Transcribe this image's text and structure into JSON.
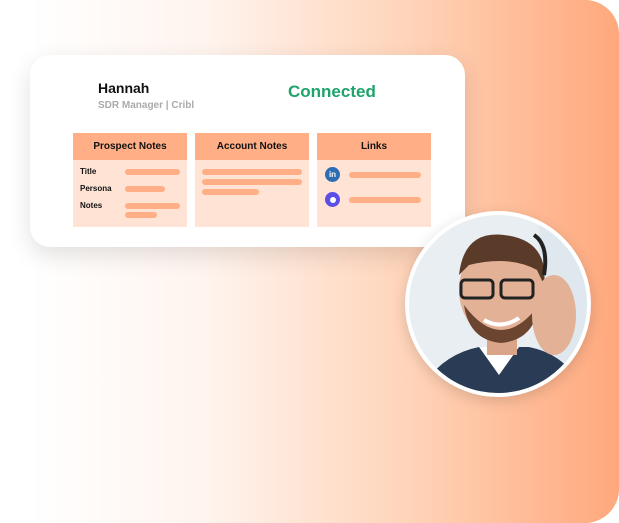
{
  "contact": {
    "name": "Hannah",
    "role": "SDR Manager | Cribl",
    "status": "Connected"
  },
  "columns": [
    {
      "title": "Prospect Notes",
      "fields": [
        "Title",
        "Persona",
        "Notes"
      ]
    },
    {
      "title": "Account Notes"
    },
    {
      "title": "Links",
      "icons": [
        "linkedin-icon",
        "outreach-icon"
      ]
    }
  ],
  "colors": {
    "accent": "#ffae85",
    "status": "#1ea36b",
    "panel": "#ffe3d5"
  }
}
